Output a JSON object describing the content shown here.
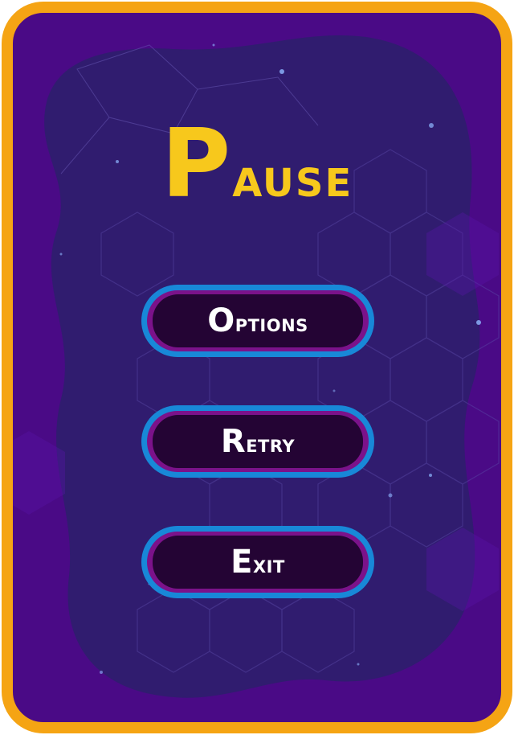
{
  "title": "Pause",
  "buttons": {
    "options": "Options",
    "retry": "Retry",
    "exit": "Exit"
  },
  "colors": {
    "frame_border": "#f5a414",
    "background": "#4a0a86",
    "inner_panel": "#2e1e6e",
    "title": "#f7c81c",
    "button_outline": "#1888d8",
    "button_rim": "#7b128a",
    "button_fill": "#240434",
    "button_text": "#ffffff"
  }
}
